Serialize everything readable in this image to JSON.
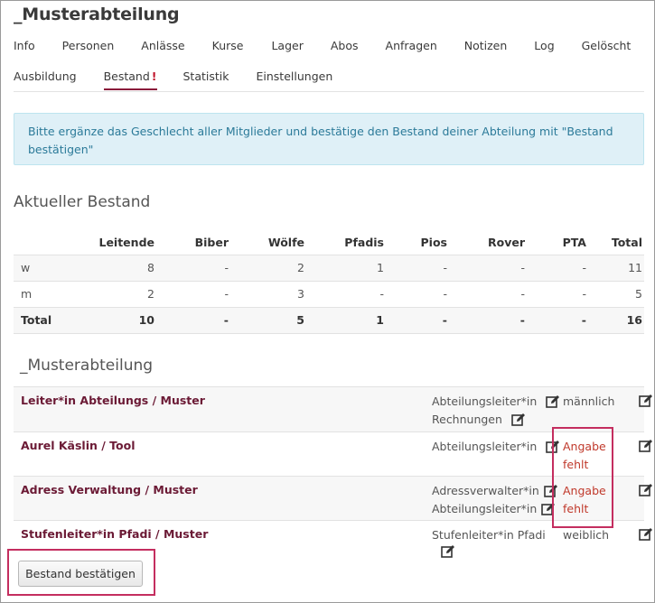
{
  "page": {
    "title": "_Musterabteilung"
  },
  "tabs_row1": [
    "Info",
    "Personen",
    "Anlässe",
    "Kurse",
    "Lager",
    "Abos",
    "Anfragen",
    "Notizen",
    "Log",
    "Gelöscht"
  ],
  "tabs_row2": [
    "Ausbildung",
    "Bestand",
    "Statistik",
    "Einstellungen"
  ],
  "active_tab": "Bestand",
  "active_tab_badge": "!",
  "alert": {
    "text": "Bitte ergänze das Geschlecht aller Mitglieder und bestätige den Bestand deiner Abteilung mit \"Bestand bestätigen\""
  },
  "current_stock": {
    "heading": "Aktueller Bestand",
    "columns": [
      "",
      "Leitende",
      "Biber",
      "Wölfe",
      "Pfadis",
      "Pios",
      "Rover",
      "PTA",
      "Total"
    ],
    "rows": [
      [
        "w",
        "8",
        "-",
        "2",
        "1",
        "-",
        "-",
        "-",
        "11"
      ],
      [
        "m",
        "2",
        "-",
        "3",
        "-",
        "-",
        "-",
        "-",
        "5"
      ],
      [
        "Total",
        "10",
        "-",
        "5",
        "1",
        "-",
        "-",
        "-",
        "16"
      ]
    ]
  },
  "group": {
    "heading": "_Musterabteilung",
    "members": [
      {
        "name": "Leiter*in Abteilungs / Muster",
        "roles": [
          "Abteilungsleiter*in",
          "Rechnungen"
        ],
        "gender": "männlich",
        "gender_missing": false
      },
      {
        "name": "Aurel Käslin / Tool",
        "roles": [
          "Abteilungsleiter*in"
        ],
        "gender": "Angabe fehlt",
        "gender_missing": true
      },
      {
        "name": "Adress Verwaltung / Muster",
        "roles": [
          "Adressverwalter*in",
          "Abteilungsleiter*in"
        ],
        "gender": "Angabe fehlt",
        "gender_missing": true
      },
      {
        "name": "Stufenleiter*in Pfadi / Muster",
        "roles": [
          "Stufenleiter*in Pfadi"
        ],
        "gender": "weiblich",
        "gender_missing": false
      }
    ]
  },
  "confirm_button": {
    "label": "Bestand bestätigen"
  },
  "colors": {
    "brand": "#6b1a35",
    "alert_bg": "#dff0f7",
    "alert_text": "#2b7a99",
    "missing": "#c0392b",
    "highlight": "#c42e5f"
  },
  "icons": {
    "edit": "edit-icon"
  }
}
